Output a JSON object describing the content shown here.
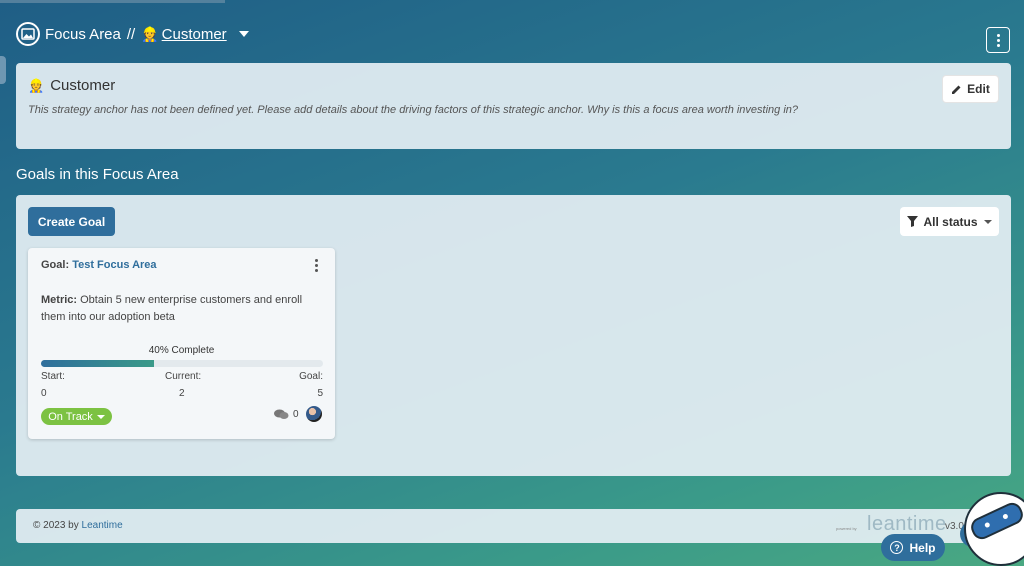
{
  "header": {
    "title": "Focus Area",
    "separator": "//",
    "anchor_emoji": "👷",
    "anchor_name": "Customer"
  },
  "strategy": {
    "emoji": "👷",
    "title": "Customer",
    "description": "This strategy anchor has not been defined yet. Please add details about the driving factors of this strategic anchor. Why is this a focus area worth investing in?",
    "edit_label": "Edit"
  },
  "goals_section": {
    "title": "Goals in this Focus Area",
    "create_label": "Create Goal",
    "filter_label": "All status"
  },
  "goal_card": {
    "goal_prefix": "Goal:",
    "goal_name": "Test Focus Area",
    "metric_prefix": "Metric:",
    "metric_text": "Obtain 5 new enterprise customers and enroll them into our adoption beta",
    "complete_label": "40% Complete",
    "progress_percent": 40,
    "start_label": "Start:",
    "current_label": "Current:",
    "goal_label": "Goal:",
    "start_value": "0",
    "current_value": "2",
    "goal_value": "5",
    "status": "On Track",
    "comment_count": "0"
  },
  "footer": {
    "copyright": "© 2023 by",
    "brand_link": "Leantime",
    "powered_by": "powered by",
    "brand_logo": "leantime",
    "version": "v3.0"
  },
  "help": {
    "label": "Help"
  },
  "colors": {
    "primary": "#2f6e9c",
    "status_green": "#7cc242",
    "teal": "#3a9a89"
  }
}
